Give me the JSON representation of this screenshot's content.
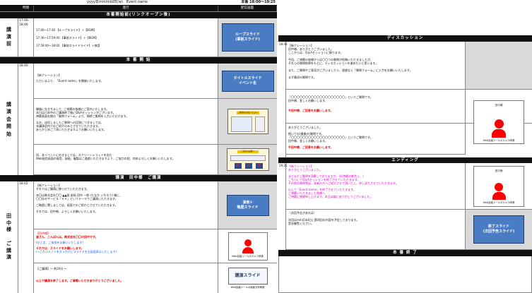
{
  "title": "yyyy年mm月dd日(w)　Event name",
  "title_right": "本番 18:00〜19:25",
  "headers": {
    "time": "時間",
    "script": "進行",
    "media": "配信画面"
  },
  "sections": {
    "opening_pre": "本番開始前(リンクオープン後)",
    "start": "本 番 開 始",
    "tanaka": "講演　田中様　ご講演",
    "discussion": "ディスカッション",
    "ending": "エンディング",
    "end": "本 番 終 了"
  },
  "row_pre": {
    "name": "講\n演\n前",
    "time": "17:00-\n18:00",
    "lines": [
      "17:00〜17:30 【ループスライド】＋【BGM】",
      "17:30〜17:59:40 【事前スライド】＋【BGM】",
      "17:59:40〜18:00 【事前スライドライド】＋無音"
    ],
    "slide": "ループスライド\n(事前スライド)"
  },
  "row_start": {
    "name": "講\n演\n会\n開\n始",
    "time": "18:00",
    "block1": [
      "【新ナレーション】",
      "ただいまより、「Event name」を開催いたします。"
    ],
    "slide1": "タイトルスライド\nイベント名",
    "block2": [
      "開催に先立ちまして、ご視聴の皆様にご案内いたします。",
      "本日は日本中のご講演終了後にQ&Aセッションがございます。",
      "視聴画面右側の「質問フォーム」より、随時ご質問を入力いただけます。",
      "",
      "なお、送信しましたご質問への回答につきましては、",
      "本講演会内でのご紹介のみとさせていただきます。",
      "あらかじめご了承いただきますようお願いいたします。"
    ],
    "thumb1_title": "ご質問をお寄せください",
    "block3": [
      "尚、本イベントにおきましては、スクリーンショットを含む",
      "Web配信画面の録音、録画、複製はご遠慮いただきますよう、ご協力の程、何卒よろしくお願いいたします。"
    ],
    "thumb2_title": "ご協力のお願い"
  },
  "row_tanaka": {
    "name": "田\n中\n様\n\nご\n講\n演",
    "time": "18:02",
    "block1": [
      "【新ナレーション】",
      "それではご講演に移らせていただきます。",
      "",
      "本日は株式会社〇〇 ▲▲部 部長 田中 一郎 (たなか いちろう) 様に、",
      "〇〇社のサービス「＊＊」というテーマでご講演いただきます。",
      "",
      "ご略歴に関しましては、画面でのご紹介とさせていただきます。",
      "",
      "それでは、田中様、よろしくお願いいたします。"
    ],
    "slide1": "演者①\n略歴スライド",
    "block2_head": "【田中様】",
    "block2_red1": "皆さん、こんばんは。株式会社〇〇の田中です。",
    "block2_blue1": "(ひと言、ご挨拶をお願いいたします)",
    "block2_red2": "それでは、スライドをお願いします。",
    "block2_blue2": "(→このコメントをきっかけにスライドを全画面表示いたします)",
    "cam1_caption": "Web会議ツールのカメラ映像",
    "block3_head": "【ご講演】〜 約20分 〜",
    "block3_red": "以上で講演を終了します。ご清聴いただきありがとうございました。",
    "slide2": "講演スライド",
    "cam2_caption": "Web会議ツールの画面共有映像"
  },
  "row_disc": {
    "time": "18:33",
    "block1": [
      "【新ナレーション】",
      "田中様、ありがとうございました。",
      "ここからは、Q＆Aセッションに移ります。",
      "",
      "今回、ご視聴の皆様からは〇〇つの質問が投稿いただきましたが、",
      "それらの質問結果をもとに、ディスカッションを進めたいと思います。",
      "",
      "また、ご質問やご意見がございましたら、遠慮なく「質問フォーム」に入力をお願いいたします。",
      "",
      "まず最初の質問です。"
    ],
    "block2": [
      "「〇〇〇〇〇〇〇〇〇〇〇〇〇〇〇〇〇〇〇」というご質問です。",
      "田中様、宜しくお願いします。"
    ],
    "block2_red": "※田中様、ご回答をお願いします。",
    "cam_label": "田中様",
    "cam_caption": "Web会議ツールのカメラ映像",
    "block3": [
      "ありがとうございました。",
      "",
      "続いての(最後の)質問です。",
      "「〇〇〇〇〇〇〇〇〇〇〇〇〇〇〇〇〇〇〇」というご質問です。",
      "田中様、宜しくお願いします。"
    ],
    "block3_red": "※田中様、ご回答をお願いします。"
  },
  "row_end": {
    "time": "19:25",
    "block1_head": "【新ナレーション】",
    "block1_lines": [
      "ありがとうございました。",
      "",
      "まだまだご質問を頂戴しておりますが、(お時間の都合上、)",
      "こちらにてQ＆Aセッションを終了させていただきます。",
      "その他の質問等は、演者の方へご紹介させて頂いた上、申し送りさせていただきます。",
      "",
      "以上で「Event name」を終了させていただきます。",
      "ご視聴いただきました皆様へ、",
      "ご視聴に感謝申し上げます。本日は誠にありがとうございました。"
    ],
    "cam_label": "田中様",
    "cam_caption": "Web会議ツールのカメラ映像",
    "block2": [
      "（次回予告があれば）",
      "",
      "次回はmm月dd日に第四回の内容を予定しております。",
      "是非御覧ください。"
    ],
    "slide": "終了スライド\n(次回予告スライド)"
  }
}
